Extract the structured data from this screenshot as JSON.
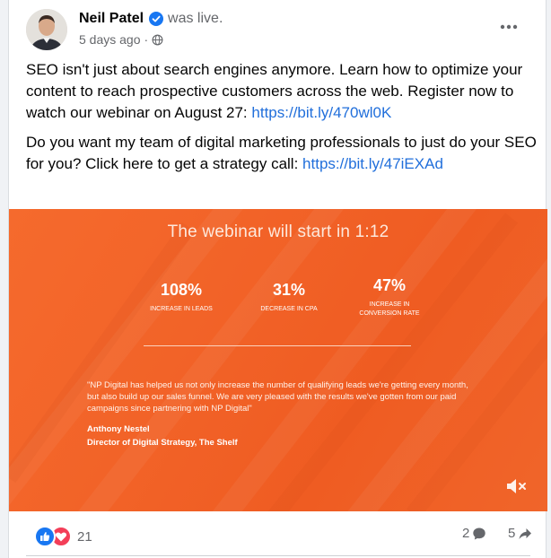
{
  "post": {
    "author": "Neil Patel",
    "action": "was live.",
    "time": "5 days ago",
    "paragraph1": "SEO isn't just about search engines anymore. Learn how to optimize your content to reach prospective customers across the web. Register now to watch our webinar on August 27: ",
    "link1": "https://bit.ly/470wl0K",
    "paragraph2": "Do you want my team of digital marketing professionals to just do your SEO for you? Click here to get a strategy call: ",
    "link2": "https://bit.ly/47iEXAd"
  },
  "video": {
    "title": "The webinar will start in 1:12",
    "stats": [
      {
        "value": "108%",
        "label": "INCREASE IN LEADS"
      },
      {
        "value": "31%",
        "label": "DECREASE IN CPA"
      },
      {
        "value": "47%",
        "label": "INCREASE IN CONVERSION RATE"
      }
    ],
    "quote": "\"NP Digital has helped us not only increase the number of qualifying leads we're getting every month, but also build up our sales funnel. We are very pleased with the results we've gotten from our paid campaigns since partnering with NP Digital\"",
    "quote_name": "Anthony Nestel",
    "quote_role": "Director of Digital Strategy, The Shelf",
    "mute_icon": "speaker-muted-icon"
  },
  "footer": {
    "reaction_count": "21",
    "comment_count": "2",
    "share_count": "5"
  },
  "colors": {
    "accent_link": "#216fdb",
    "video_orange": "#f26328",
    "like_blue": "#1877f2",
    "love_red": "#f33e58",
    "verified_blue": "#1877f2"
  }
}
